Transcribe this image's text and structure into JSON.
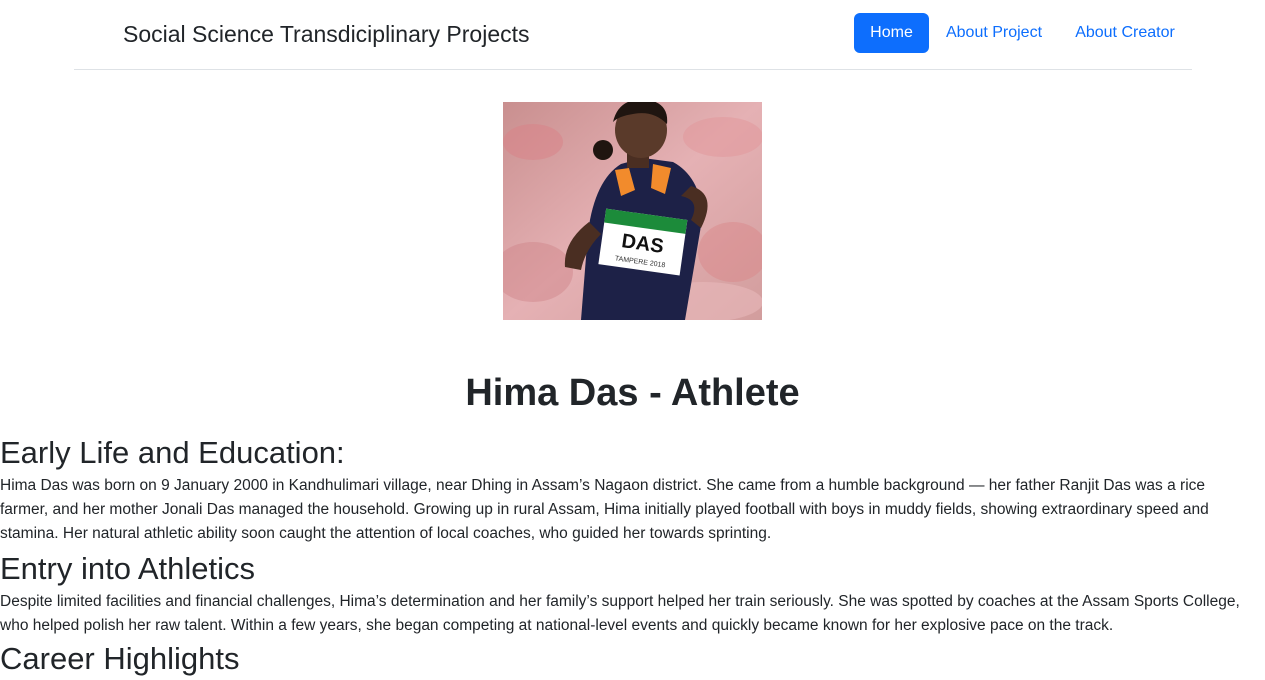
{
  "navbar": {
    "brand": "Social Science Transdiciplinary Projects",
    "links": [
      {
        "label": "Home",
        "active": true
      },
      {
        "label": "About Project",
        "active": false
      },
      {
        "label": "About Creator",
        "active": false
      }
    ]
  },
  "hero": {
    "bib_name": "DAS",
    "bib_event": "TAMPERE 2018"
  },
  "main": {
    "title": "Hima Das - Athlete",
    "sections": [
      {
        "heading": "Early Life and Education:",
        "text": "Hima Das was born on 9 January 2000 in Kandhulimari village, near Dhing in Assam’s Nagaon district. She came from a humble background — her father Ranjit Das was a rice farmer, and her mother Jonali Das managed the household. Growing up in rural Assam, Hima initially played football with boys in muddy fields, showing extraordinary speed and stamina. Her natural athletic ability soon caught the attention of local coaches, who guided her towards sprinting."
      },
      {
        "heading": "Entry into Athletics",
        "text": "Despite limited facilities and financial challenges, Hima’s determination and her family’s support helped her train seriously. She was spotted by coaches at the Assam Sports College, who helped polish her raw talent. Within a few years, she began competing at national-level events and quickly became known for her explosive pace on the track."
      },
      {
        "heading": "Career Highlights",
        "text": ""
      }
    ]
  },
  "colors": {
    "primary": "#0d6efd",
    "text": "#212529",
    "divider": "#dee2e6"
  }
}
